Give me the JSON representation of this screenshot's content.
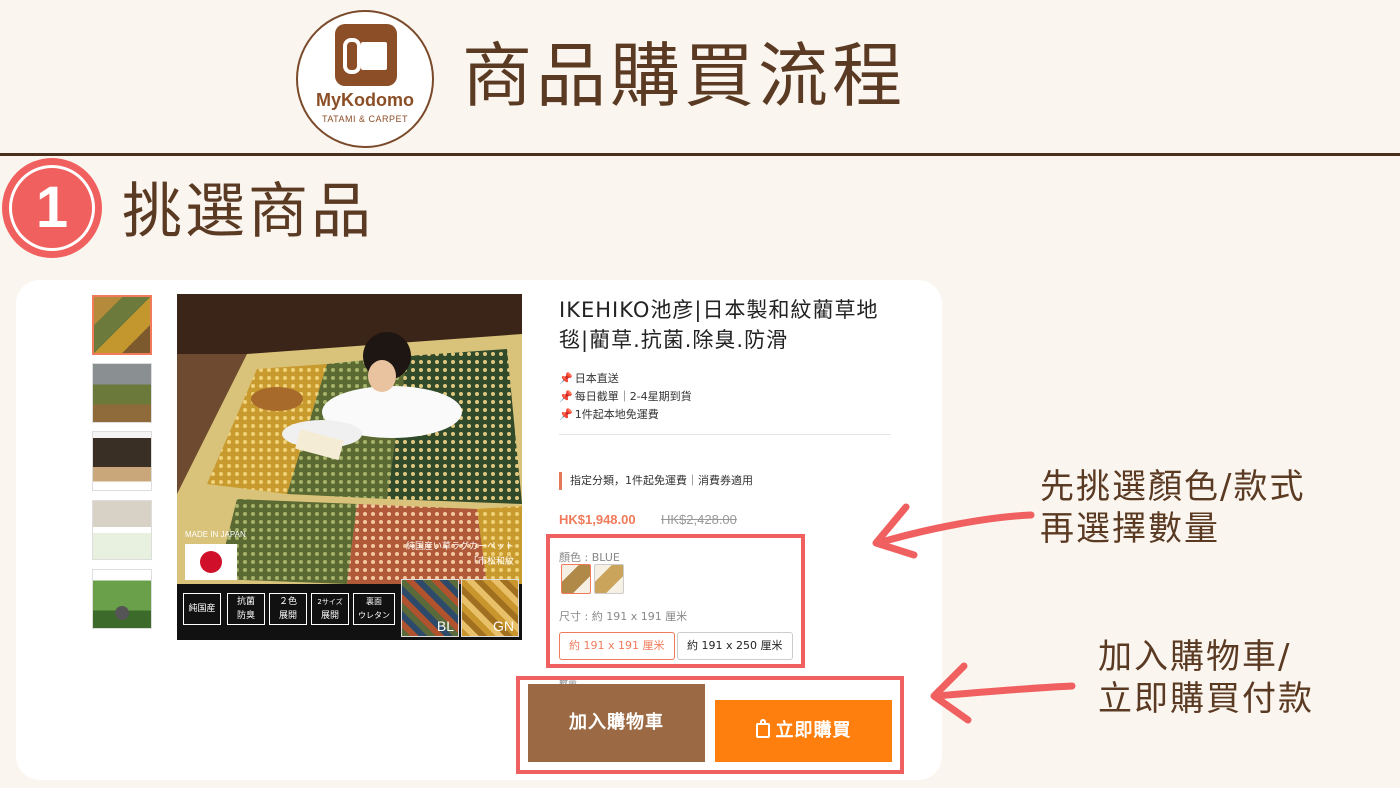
{
  "header": {
    "logo_brand": "MyKodomo",
    "logo_tagline": "TATAMI & CARPET",
    "title": "商品購買流程"
  },
  "step": {
    "number": "1",
    "title": "挑選商品"
  },
  "product": {
    "image_overlay": {
      "made_in": "MADE IN JAPAN",
      "caption_line1": "純国産い草ラグカーペット",
      "caption_line2": "「市松和紋",
      "features": [
        {
          "line1": "純国産",
          "line2": ""
        },
        {
          "line1": "抗菌",
          "line2": "防臭"
        },
        {
          "line1": "２色",
          "line2": "展開"
        },
        {
          "line1": "2サイズ",
          "line2": "展開"
        },
        {
          "line1": "裏面",
          "line2": "ウレタン"
        }
      ],
      "swatch_labels": [
        "BL",
        "GN"
      ]
    },
    "name": "IKEHIKO池彦|日本製和紋藺草地毯|藺草.抗菌.除臭.防滑",
    "bullets": [
      "日本直送",
      "每日截單｜2-4星期到貨",
      "1件起本地免運費"
    ],
    "promo": "指定分類，1件起免運費｜消費券適用",
    "price": "HK$1,948.00",
    "old_price": "HK$2,428.00",
    "color_label": "顏色 : BLUE",
    "size_label": "尺寸 : 約 191 x 191 厘米",
    "sizes": [
      "約 191 x 191 厘米",
      "約 191 x 250 厘米"
    ],
    "selected_size_index": 0,
    "qty_label": "數量",
    "add_to_cart": "加入購物車",
    "buy_now": "立即購買"
  },
  "annotations": {
    "select_line1": "先挑選顏色/款式",
    "select_line2": "再選擇數量",
    "cart_line1": "加入購物車/",
    "cart_line2": "立即購買付款"
  },
  "colors": {
    "accent": "#f06060",
    "price": "#f07a5a",
    "cart_button": "#9b6a44",
    "buy_button": "#ff7f0e",
    "brand_brown": "#8b4e26"
  }
}
